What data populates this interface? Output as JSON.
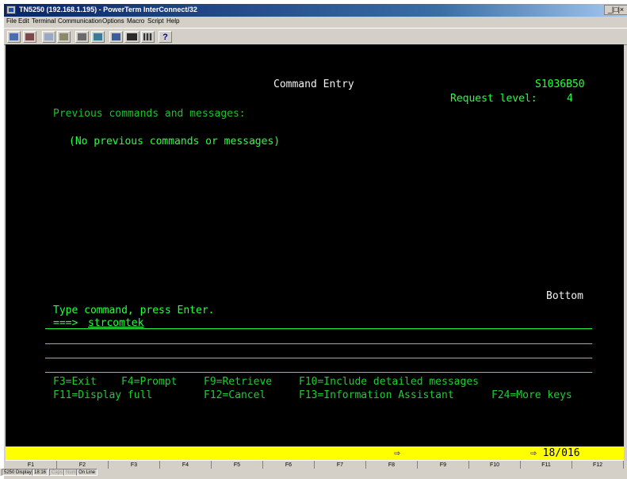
{
  "window": {
    "title": "TN5250 (192.168.1.195) - PowerTerm InterConnect/32",
    "controls": "_|□|×"
  },
  "menu": [
    "File",
    "Edit",
    "Terminal",
    "Communication",
    "Options",
    "Macro",
    "Script",
    "Help"
  ],
  "toolbar": {
    "icons": [
      "connect-icon",
      "disconnect-icon",
      "copy-icon",
      "paste-icon",
      "print-icon",
      "printer-setup-icon",
      "session-icon",
      "keyboard-icon",
      "grid-icon",
      "help-icon"
    ],
    "help_glyph": "?"
  },
  "screen": {
    "heading": "Command Entry",
    "system_name": "S1036B50",
    "request_level_label": "Request level:",
    "request_level_value": "4",
    "previous_label": "Previous commands and messages:",
    "no_previous": "(No previous commands or messages)",
    "bottom_indicator": "Bottom",
    "instruction": "Type command, press Enter.",
    "prompt_arrow": "===>",
    "command_value": "strcomtek",
    "fkeys_row1": [
      "F3=Exit",
      "F4=Prompt",
      "F9=Retrieve",
      "F10=Include detailed messages"
    ],
    "fkeys_row2": [
      "F11=Display full",
      "F12=Cancel",
      "F13=Information Assistant",
      "F24=More keys"
    ]
  },
  "status_line": {
    "arrow": "⇨",
    "cursor_position": "⇨ 18/016"
  },
  "function_keys": [
    "F1",
    "F2",
    "F3",
    "F4",
    "F5",
    "F6",
    "F7",
    "F8",
    "F9",
    "F10",
    "F11",
    "F12"
  ],
  "statusbar": {
    "mode": "5250 Display",
    "time": "18:16",
    "caps": "Caps",
    "num": "Num",
    "online": "On Line"
  },
  "colors": {
    "terminal_bg": "#000000",
    "terminal_green": "#27ff40",
    "terminal_white": "#f2f2f2",
    "status_yellow": "#ffff00",
    "titlebar_blue": "#0a246a"
  }
}
